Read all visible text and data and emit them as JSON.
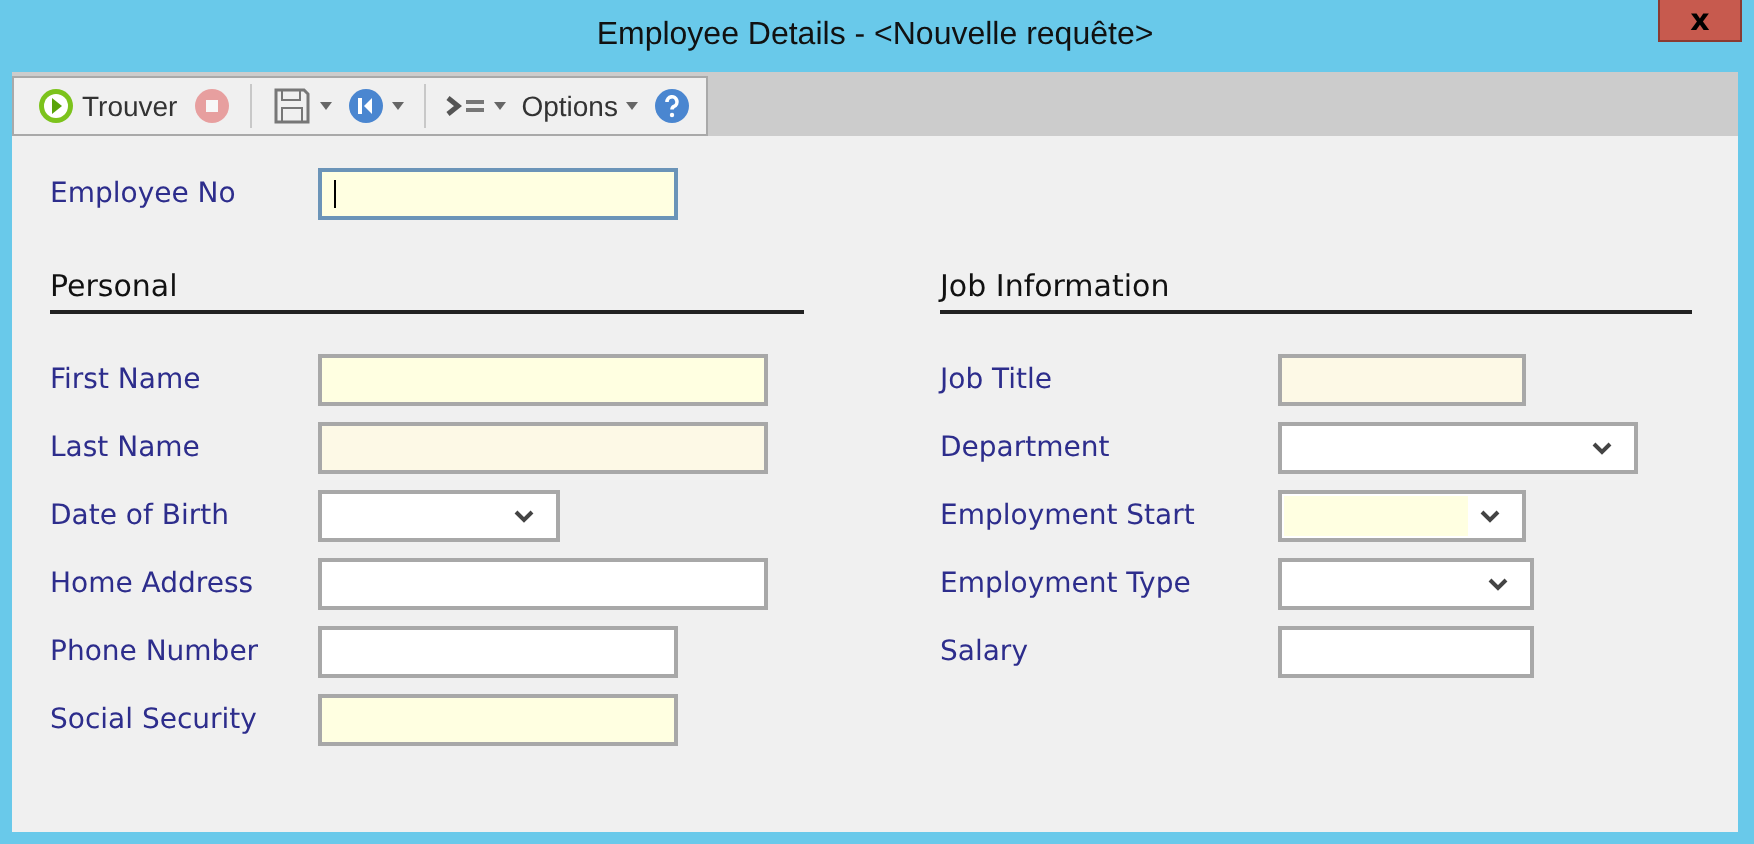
{
  "window": {
    "title": "Employee Details - <Nouvelle requête>",
    "close": "x"
  },
  "toolbar": [
    {
      "kind": "run",
      "label": "Trouver",
      "disabled": false
    },
    {
      "kind": "stop",
      "disabled": true
    },
    {
      "kind": "separator"
    },
    {
      "kind": "save",
      "menu": true,
      "disabled": false
    },
    {
      "kind": "first",
      "menu": true,
      "disabled": false
    },
    {
      "kind": "separator"
    },
    {
      "kind": "indent",
      "menu": true,
      "disabled": false
    },
    {
      "kind": "options",
      "label": "Options",
      "menu": true,
      "disabled": false
    },
    {
      "kind": "help",
      "disabled": false
    }
  ],
  "employee_no": {
    "label": "Employee No",
    "kind": "text",
    "color": "#ffffe1",
    "focused": true
  },
  "sections": [
    {
      "title": "Personal",
      "fields": [
        {
          "label": "First Name",
          "kind": "text",
          "color": "#ffffe1",
          "focused": false
        },
        {
          "label": "Last Name",
          "kind": "text",
          "color": "#fdf9e6",
          "focused": false
        },
        {
          "label": "Date of Birth",
          "kind": "dropdown",
          "color": "#ffffff",
          "focused": false
        },
        {
          "label": "Home Address",
          "kind": "text",
          "color": "#ffffff",
          "focused": false
        },
        {
          "label": "Phone Number",
          "kind": "text",
          "color": "#ffffff",
          "focused": false
        },
        {
          "label": "Social Security",
          "kind": "text",
          "color": "#ffffe1",
          "focused": false
        }
      ]
    },
    {
      "title": "Job Information",
      "fields": [
        {
          "label": "Job Title",
          "kind": "text",
          "color": "#fdf9e6",
          "focused": false
        },
        {
          "label": "Department",
          "kind": "dropdown",
          "color": "#ffffff",
          "focused": false
        },
        {
          "label": "Employment Start",
          "kind": "dropdown",
          "color": "#ffffe1",
          "focused": false
        },
        {
          "label": "Employment Type",
          "kind": "dropdown",
          "color": "#ffffff",
          "focused": false
        },
        {
          "label": "Salary",
          "kind": "text",
          "color": "#ffffff",
          "focused": false
        }
      ]
    }
  ]
}
